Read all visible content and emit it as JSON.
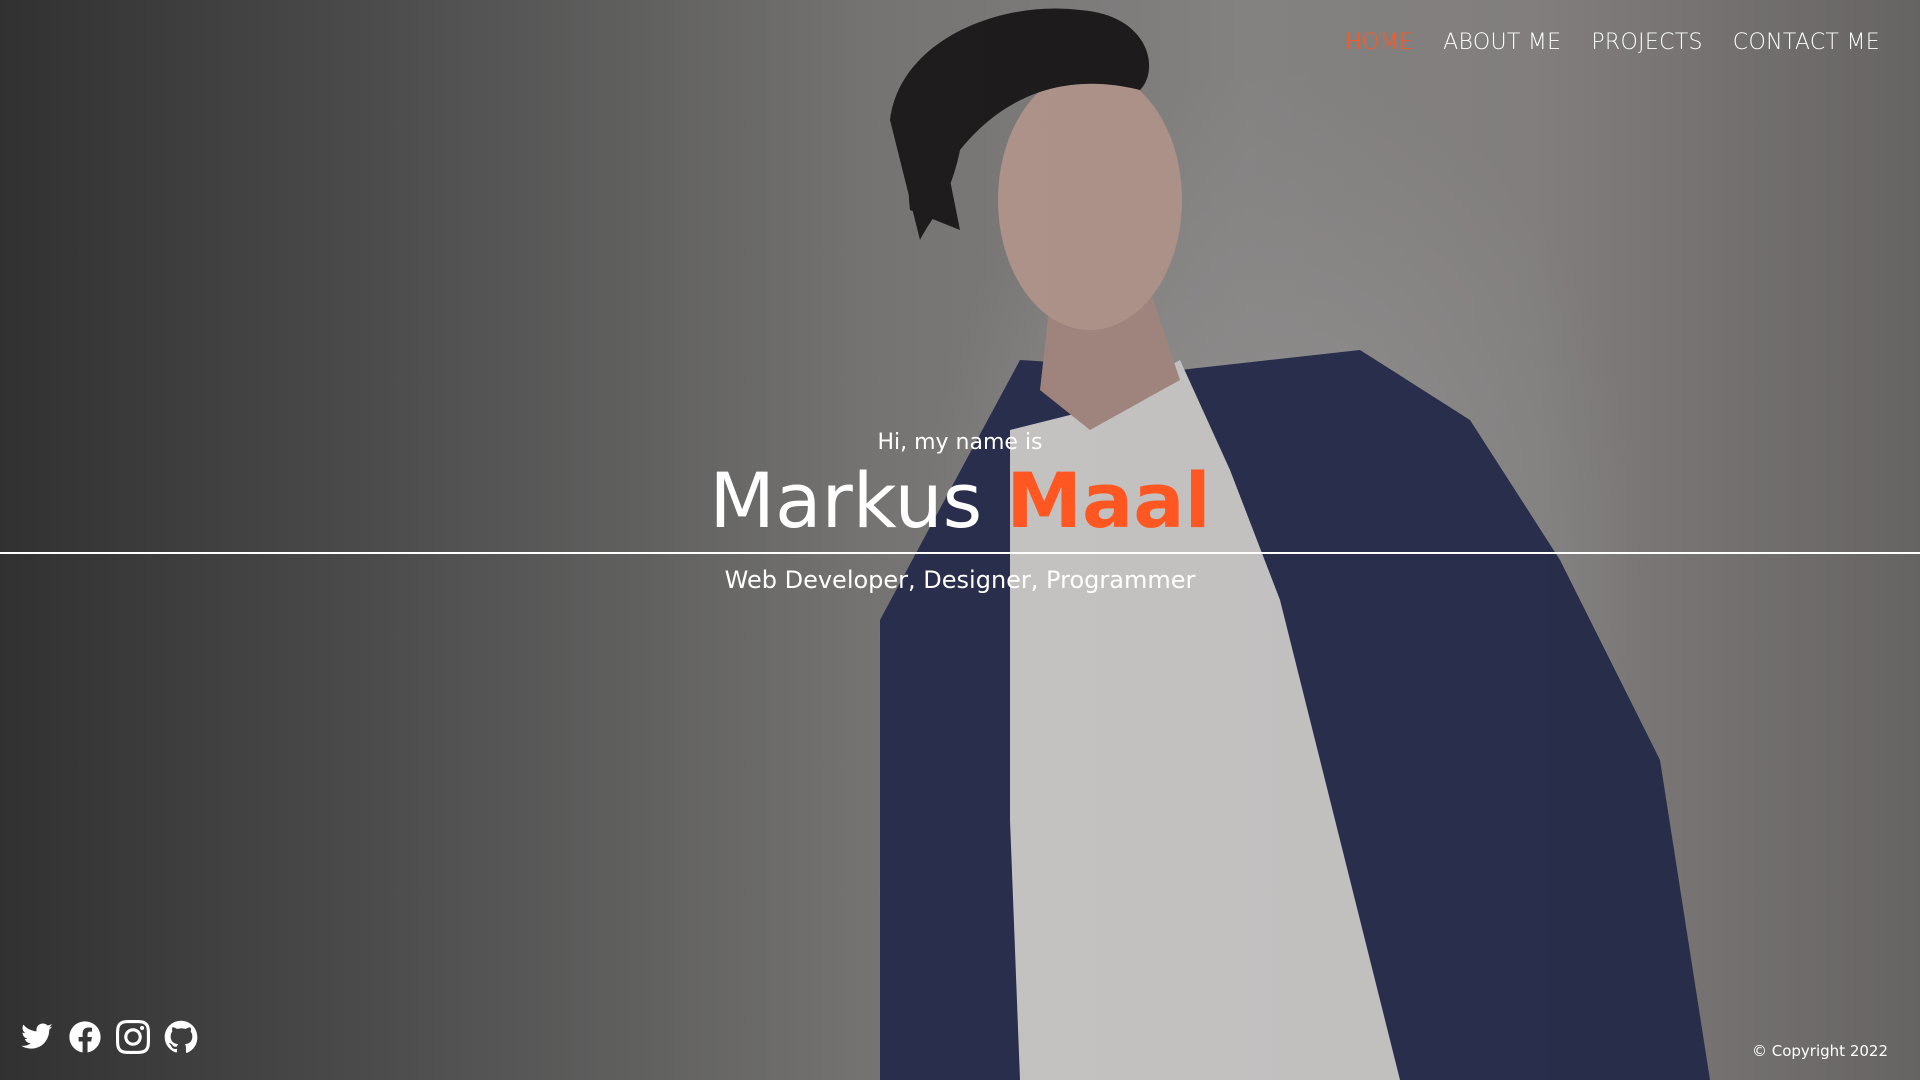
{
  "nav": {
    "items": [
      {
        "label": "HOME",
        "active": true
      },
      {
        "label": "ABOUT ME",
        "active": false
      },
      {
        "label": "PROJECTS",
        "active": false
      },
      {
        "label": "CONTACT ME",
        "active": false
      }
    ]
  },
  "hero": {
    "greeting": "Hi, my name is",
    "first_name": "Markus",
    "last_name": "Maal",
    "roles": "Web Developer, Designer, Programmer"
  },
  "social": {
    "icons": [
      "twitter-icon",
      "facebook-icon",
      "instagram-icon",
      "github-icon"
    ]
  },
  "footer": {
    "copyright": "© Copyright 2022"
  },
  "colors": {
    "accent": "#ff5722",
    "text": "#ffffff"
  }
}
